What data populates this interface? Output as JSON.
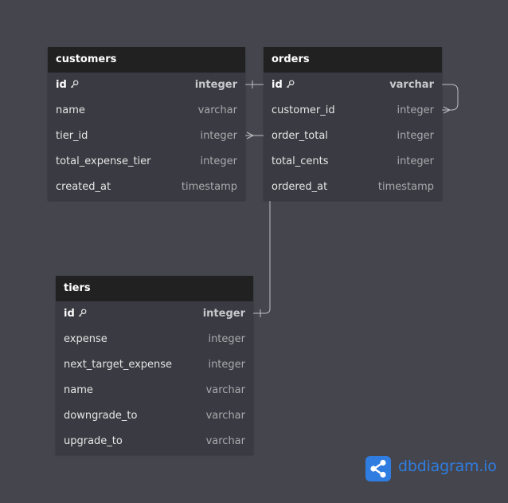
{
  "tables": [
    {
      "name": "customers",
      "columns": [
        {
          "name": "id",
          "type": "integer",
          "pk": true
        },
        {
          "name": "name",
          "type": "varchar"
        },
        {
          "name": "tier_id",
          "type": "integer"
        },
        {
          "name": "total_expense_tier",
          "type": "integer"
        },
        {
          "name": "created_at",
          "type": "timestamp"
        }
      ]
    },
    {
      "name": "orders",
      "columns": [
        {
          "name": "id",
          "type": "varchar",
          "pk": true
        },
        {
          "name": "customer_id",
          "type": "integer"
        },
        {
          "name": "order_total",
          "type": "integer"
        },
        {
          "name": "total_cents",
          "type": "integer"
        },
        {
          "name": "ordered_at",
          "type": "timestamp"
        }
      ]
    },
    {
      "name": "tiers",
      "columns": [
        {
          "name": "id",
          "type": "integer",
          "pk": true
        },
        {
          "name": "expense",
          "type": "integer"
        },
        {
          "name": "next_target_expense",
          "type": "integer"
        },
        {
          "name": "name",
          "type": "varchar"
        },
        {
          "name": "downgrade_to",
          "type": "varchar"
        },
        {
          "name": "upgrade_to",
          "type": "varchar"
        }
      ]
    }
  ],
  "colors": {
    "canvas": "#45454d",
    "table_body": "#3a3a42",
    "table_header": "#212121",
    "connector": "#bfbfc4",
    "brand": "#2f7de1"
  },
  "brand": {
    "name_main": "dbdiagram",
    "name_suffix": ".io",
    "icon": "share-nodes-icon"
  }
}
